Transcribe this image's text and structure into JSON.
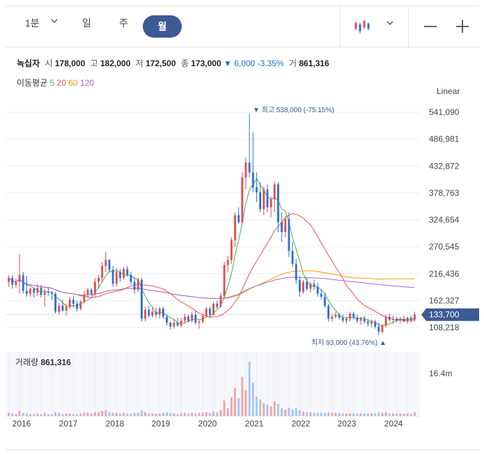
{
  "periods": {
    "minute_label": "1분",
    "day_label": "일",
    "week_label": "주",
    "month_label": "월",
    "active": "월"
  },
  "quote": {
    "name": "녹십자",
    "open_label": "시",
    "open": "178,000",
    "high_label": "고",
    "high": "182,000",
    "low_label": "저",
    "low": "172,500",
    "close_label": "종",
    "close": "173,000",
    "change_arrow": "▼",
    "change": "6,000",
    "change_pct": "-3.35%",
    "volume_label": "거",
    "volume": "861,316"
  },
  "ma_legend": {
    "label": "이동평균",
    "periods": [
      "5",
      "20",
      "60",
      "120"
    ],
    "colors": [
      "#4caf50",
      "#ef5350",
      "#ff9800",
      "#9c6ade"
    ]
  },
  "scale_mode": "Linear",
  "colors": {
    "up": "#e84a4a",
    "down": "#2f6fd8",
    "accent": "#3c5a93",
    "vol_up": "#f2a3a3",
    "vol_down": "#a8c4ee"
  },
  "icons": {
    "candle": "candlestick-icon",
    "minus": "minus-icon",
    "plus": "plus-icon",
    "chevron": "chevron-down-icon"
  },
  "chart_data": {
    "type": "candlestick",
    "y_axis": {
      "min": 80000,
      "max": 560000,
      "ticks": [
        "541,090",
        "486,981",
        "432,872",
        "378,763",
        "324,654",
        "270,545",
        "216,436",
        "162,327",
        "108,218"
      ]
    },
    "x_ticks": [
      "2016",
      "2017",
      "2018",
      "2019",
      "2020",
      "2021",
      "2022",
      "2023",
      "2024"
    ],
    "last_price": "133,700",
    "high_annotation": "▼ 최고 538,000 (-75.15%)",
    "low_annotation": "최저 93,000 (43.76%) ▲",
    "volume_title": "거래량",
    "volume_value": "861,316",
    "volume_tick": "16.4m",
    "ohlc": [
      [
        200000,
        214000,
        190000,
        208000
      ],
      [
        208000,
        214000,
        186000,
        194000
      ],
      [
        194000,
        206000,
        188000,
        200000
      ],
      [
        200000,
        256000,
        176000,
        214000
      ],
      [
        214000,
        220000,
        176000,
        182000
      ],
      [
        182000,
        212000,
        170000,
        176000
      ],
      [
        176000,
        188000,
        170000,
        186000
      ],
      [
        186000,
        188000,
        168000,
        178000
      ],
      [
        178000,
        196000,
        172000,
        188000
      ],
      [
        188000,
        194000,
        168000,
        174000
      ],
      [
        174000,
        186000,
        150000,
        180000
      ],
      [
        180000,
        190000,
        172000,
        178000
      ],
      [
        178000,
        182000,
        164000,
        176000
      ],
      [
        176000,
        180000,
        136000,
        140000
      ],
      [
        140000,
        158000,
        134000,
        152000
      ],
      [
        152000,
        164000,
        140000,
        142000
      ],
      [
        142000,
        156000,
        132000,
        150000
      ],
      [
        150000,
        170000,
        146000,
        164000
      ],
      [
        164000,
        172000,
        148000,
        156000
      ],
      [
        156000,
        162000,
        140000,
        146000
      ],
      [
        146000,
        164000,
        142000,
        160000
      ],
      [
        160000,
        182000,
        156000,
        174000
      ],
      [
        174000,
        188000,
        168000,
        184000
      ],
      [
        184000,
        188000,
        172000,
        176000
      ],
      [
        176000,
        208000,
        170000,
        200000
      ],
      [
        200000,
        214000,
        188000,
        208000
      ],
      [
        208000,
        240000,
        200000,
        232000
      ],
      [
        232000,
        260000,
        220000,
        244000
      ],
      [
        244000,
        246000,
        218000,
        224000
      ],
      [
        224000,
        232000,
        190000,
        196000
      ],
      [
        196000,
        228000,
        190000,
        220000
      ],
      [
        220000,
        226000,
        200000,
        208000
      ],
      [
        208000,
        230000,
        204000,
        226000
      ],
      [
        226000,
        232000,
        210000,
        214000
      ],
      [
        214000,
        220000,
        194000,
        200000
      ],
      [
        200000,
        210000,
        176000,
        184000
      ],
      [
        184000,
        208000,
        180000,
        204000
      ],
      [
        204000,
        208000,
        120000,
        126000
      ],
      [
        126000,
        150000,
        120000,
        144000
      ],
      [
        144000,
        152000,
        128000,
        132000
      ],
      [
        132000,
        150000,
        128000,
        140000
      ],
      [
        140000,
        148000,
        128000,
        134000
      ],
      [
        134000,
        150000,
        126000,
        146000
      ],
      [
        146000,
        150000,
        126000,
        130000
      ],
      [
        130000,
        134000,
        112000,
        118000
      ],
      [
        118000,
        120000,
        104000,
        110000
      ],
      [
        110000,
        124000,
        106000,
        118000
      ],
      [
        118000,
        128000,
        110000,
        112000
      ],
      [
        112000,
        128000,
        108000,
        122000
      ],
      [
        122000,
        136000,
        116000,
        130000
      ],
      [
        130000,
        134000,
        118000,
        122000
      ],
      [
        122000,
        140000,
        118000,
        134000
      ],
      [
        134000,
        142000,
        114000,
        118000
      ],
      [
        118000,
        124000,
        106000,
        120000
      ],
      [
        120000,
        136000,
        116000,
        132000
      ],
      [
        132000,
        150000,
        128000,
        146000
      ],
      [
        146000,
        150000,
        130000,
        134000
      ],
      [
        134000,
        160000,
        132000,
        156000
      ],
      [
        156000,
        162000,
        146000,
        150000
      ],
      [
        150000,
        178000,
        148000,
        172000
      ],
      [
        172000,
        240000,
        166000,
        234000
      ],
      [
        234000,
        252000,
        220000,
        244000
      ],
      [
        244000,
        290000,
        236000,
        284000
      ],
      [
        284000,
        340000,
        270000,
        334000
      ],
      [
        334000,
        350000,
        316000,
        320000
      ],
      [
        320000,
        420000,
        316000,
        410000
      ],
      [
        410000,
        450000,
        386000,
        440000
      ],
      [
        440000,
        538000,
        410000,
        420000
      ],
      [
        420000,
        500000,
        380000,
        390000
      ],
      [
        390000,
        420000,
        360000,
        380000
      ],
      [
        380000,
        400000,
        340000,
        346000
      ],
      [
        346000,
        392000,
        334000,
        386000
      ],
      [
        386000,
        396000,
        340000,
        350000
      ],
      [
        350000,
        372000,
        330000,
        366000
      ],
      [
        366000,
        402000,
        340000,
        396000
      ],
      [
        396000,
        400000,
        300000,
        320000
      ],
      [
        320000,
        340000,
        280000,
        300000
      ],
      [
        300000,
        332000,
        290000,
        326000
      ],
      [
        326000,
        340000,
        250000,
        262000
      ],
      [
        262000,
        280000,
        230000,
        236000
      ],
      [
        236000,
        246000,
        196000,
        204000
      ],
      [
        204000,
        212000,
        170000,
        180000
      ],
      [
        180000,
        204000,
        176000,
        200000
      ],
      [
        200000,
        208000,
        182000,
        186000
      ],
      [
        186000,
        200000,
        178000,
        196000
      ],
      [
        196000,
        204000,
        184000,
        190000
      ],
      [
        190000,
        198000,
        170000,
        176000
      ],
      [
        176000,
        186000,
        164000,
        170000
      ],
      [
        170000,
        176000,
        148000,
        152000
      ],
      [
        152000,
        156000,
        120000,
        126000
      ],
      [
        126000,
        136000,
        120000,
        130000
      ],
      [
        130000,
        140000,
        126000,
        134000
      ],
      [
        134000,
        138000,
        124000,
        128000
      ],
      [
        128000,
        134000,
        118000,
        122000
      ],
      [
        122000,
        130000,
        116000,
        126000
      ],
      [
        126000,
        140000,
        120000,
        136000
      ],
      [
        136000,
        140000,
        124000,
        128000
      ],
      [
        128000,
        134000,
        118000,
        122000
      ],
      [
        122000,
        130000,
        114000,
        126000
      ],
      [
        126000,
        132000,
        116000,
        120000
      ],
      [
        120000,
        126000,
        110000,
        116000
      ],
      [
        116000,
        124000,
        108000,
        120000
      ],
      [
        120000,
        124000,
        106000,
        110000
      ],
      [
        110000,
        118000,
        93000,
        100000
      ],
      [
        100000,
        116000,
        96000,
        112000
      ],
      [
        112000,
        134000,
        108000,
        130000
      ],
      [
        130000,
        136000,
        120000,
        124000
      ],
      [
        124000,
        132000,
        116000,
        126000
      ],
      [
        126000,
        130000,
        118000,
        122000
      ],
      [
        122000,
        130000,
        116000,
        126000
      ],
      [
        126000,
        132000,
        118000,
        120000
      ],
      [
        120000,
        130000,
        116000,
        128000
      ],
      [
        128000,
        132000,
        118000,
        124000
      ],
      [
        124000,
        140000,
        120000,
        134000
      ]
    ],
    "volume": [
      0.05,
      0.04,
      0.03,
      0.08,
      0.05,
      0.04,
      0.03,
      0.03,
      0.04,
      0.03,
      0.05,
      0.03,
      0.03,
      0.06,
      0.05,
      0.03,
      0.04,
      0.04,
      0.03,
      0.03,
      0.04,
      0.05,
      0.05,
      0.04,
      0.06,
      0.06,
      0.08,
      0.09,
      0.06,
      0.05,
      0.05,
      0.04,
      0.05,
      0.04,
      0.04,
      0.05,
      0.05,
      0.09,
      0.06,
      0.04,
      0.04,
      0.04,
      0.04,
      0.05,
      0.06,
      0.05,
      0.04,
      0.03,
      0.04,
      0.05,
      0.04,
      0.05,
      0.04,
      0.05,
      0.05,
      0.06,
      0.05,
      0.07,
      0.06,
      0.09,
      0.24,
      0.12,
      0.29,
      0.44,
      0.28,
      0.61,
      0.4,
      0.84,
      0.52,
      0.3,
      0.26,
      0.2,
      0.18,
      0.15,
      0.23,
      0.19,
      0.12,
      0.1,
      0.13,
      0.1,
      0.12,
      0.09,
      0.07,
      0.06,
      0.06,
      0.05,
      0.05,
      0.05,
      0.05,
      0.06,
      0.05,
      0.05,
      0.05,
      0.04,
      0.04,
      0.04,
      0.04,
      0.04,
      0.04,
      0.04,
      0.04,
      0.04,
      0.04,
      0.06,
      0.05,
      0.06,
      0.04,
      0.04,
      0.04,
      0.04,
      0.04,
      0.04,
      0.04,
      0.06
    ]
  }
}
